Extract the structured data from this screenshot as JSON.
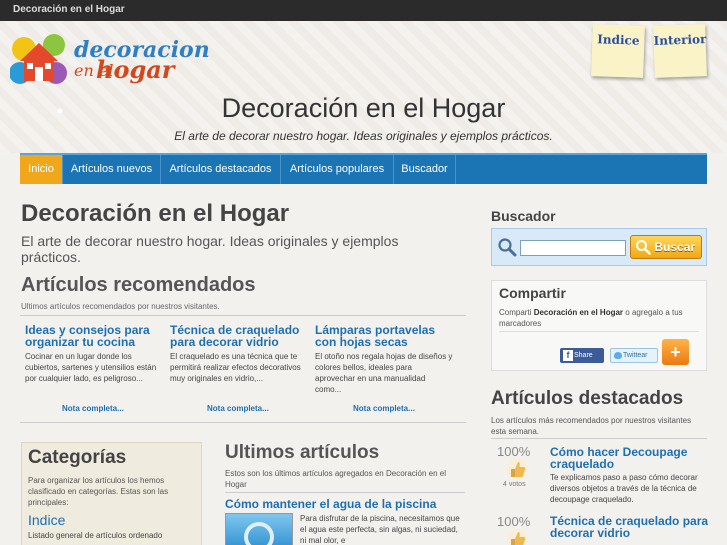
{
  "topbar": {
    "title": "Decoración en el Hogar"
  },
  "header": {
    "logo": {
      "line1": "decoracion",
      "line2": "en el",
      "line3": "hogar"
    },
    "notes": [
      {
        "label": "Indice"
      },
      {
        "label": "Interior"
      }
    ],
    "title": "Decoración en el Hogar",
    "tagline": "El arte de decorar nuestro hogar. Ideas originales y ejemplos prácticos."
  },
  "nav": {
    "items": [
      {
        "label": "Inicio"
      },
      {
        "label": "Artículos nuevos"
      },
      {
        "label": "Artículos destacados"
      },
      {
        "label": "Artículos populares"
      },
      {
        "label": "Buscador"
      }
    ]
  },
  "main": {
    "title": "Decoración en el Hogar",
    "intro": "El arte de decorar nuestro hogar. Ideas originales y ejemplos prácticos.",
    "recommended": {
      "title": "Artículos recomendados",
      "subtitle": "Ultimos artículos recomendados por nuestros visitantes.",
      "items": [
        {
          "title": "Ideas y consejos para organizar tu cocina",
          "text": "Cocinar en un lugar donde los cubiertos, sartenes y utensilios están por cualquier lado, es peligroso...",
          "more": "Nota completa..."
        },
        {
          "title": "Técnica de craquelado para decorar vidrio",
          "text": "El craquelado es una técnica que te permitirá realizar efectos decorativos muy originales en vidrio,...",
          "more": "Nota completa..."
        },
        {
          "title": "Lámparas portavelas con hojas secas",
          "text": "El otoño nos regala hojas de diseños y colores bellos, ideales para aprovechar en una manualidad como...",
          "more": "Nota completa..."
        }
      ]
    },
    "categories": {
      "title": "Categorías",
      "text": "Para organizar los artículos los hemos clasificado en categorías. Estas son las principales:",
      "link": "Indice",
      "desc": "Listado general de artículos ordenado"
    },
    "latest": {
      "title": "Ultimos artículos",
      "subtitle": "Estos son los últimos artículos agregados en Decoración en el Hogar",
      "item_title": "Cómo mantener el agua de la piscina",
      "item_text": "Para disfrutar de la piscina, necesitamos que el agua este perfecta, sin algas, ni suciedad, ni mal olor, e"
    }
  },
  "sidebar": {
    "search": {
      "title": "Buscador",
      "placeholder": "",
      "button": "Buscar"
    },
    "share": {
      "title": "Compartir",
      "text_prefix": "Comparti",
      "text_site": "Decoración en el Hogar",
      "text_suffix": "o agregalo a tus marcadores",
      "facebook": "Share",
      "twitter": "Twittear",
      "plus": "+"
    },
    "featured": {
      "title": "Artículos destacados",
      "subtitle": "Los artículos más recomendados por nuestros visitantes esta semana.",
      "items": [
        {
          "percent": "100%",
          "votes": "4 votos",
          "title": "Cómo hacer Decoupage craquelado",
          "text": "Te explicamos paso a paso cómo decorar diversos objetos a través de la técnica de decoupage craquelado."
        },
        {
          "percent": "100%",
          "title": "Técnica de craquelado para decorar vidrio"
        }
      ]
    }
  },
  "colors": {
    "nav": "#1b74b4",
    "nav_active": "#f0a81a",
    "link": "#1e6fb1",
    "topbar": "#2b2b2b"
  }
}
